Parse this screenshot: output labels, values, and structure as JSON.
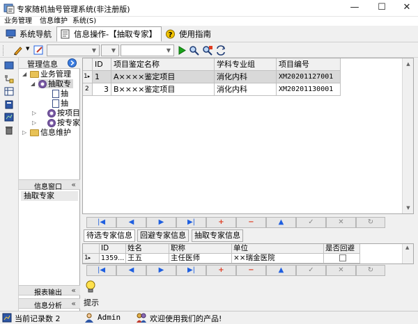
{
  "window": {
    "title": "专家随机抽号管理系统(非注册版)",
    "minimize": "—",
    "maximize": "☐",
    "close": "✕"
  },
  "menu": [
    "业务管理",
    "信息维护",
    "系统(S)"
  ],
  "tabs": [
    {
      "label": "系统导航"
    },
    {
      "label": "信息操作-【抽取专家】"
    },
    {
      "label": "使用指南"
    }
  ],
  "nav": {
    "title": "管理信息",
    "tree": {
      "business": "业务管理",
      "extract": "抽取专",
      "leaf1": "抽",
      "leaf2": "抽",
      "by_item": "按项目",
      "by_expert": "按专家",
      "maintain": "信息维护"
    },
    "info_window": "信息窗口",
    "info_window_item": "抽取专家",
    "report": "报表输出",
    "analysis": "信息分析"
  },
  "grid": {
    "columns": [
      "ID",
      "项目鉴定名称",
      "学科专业组",
      "项目编号"
    ],
    "rows": [
      {
        "num": "1",
        "id": "1",
        "name": "A××××鉴定项目",
        "group": "消化内科",
        "code": "XM20201127001"
      },
      {
        "num": "2",
        "id": "3",
        "name": "B××××鉴定项目",
        "group": "消化内科",
        "code": "XM20201130001"
      }
    ]
  },
  "subtabs": [
    "待选专家信息",
    "回避专家信息",
    "抽取专家信息"
  ],
  "subgrid": {
    "columns": [
      "ID",
      "姓名",
      "职称",
      "单位",
      "是否回避"
    ],
    "row": {
      "num": "1",
      "id": "1359...",
      "name": "王五",
      "title": "主任医师",
      "unit": "××瑞金医院"
    }
  },
  "hint": {
    "label": "提示"
  },
  "status": {
    "records": "当前记录数 2",
    "user": "Admin",
    "welcome": "欢迎使用我们的产品!"
  }
}
